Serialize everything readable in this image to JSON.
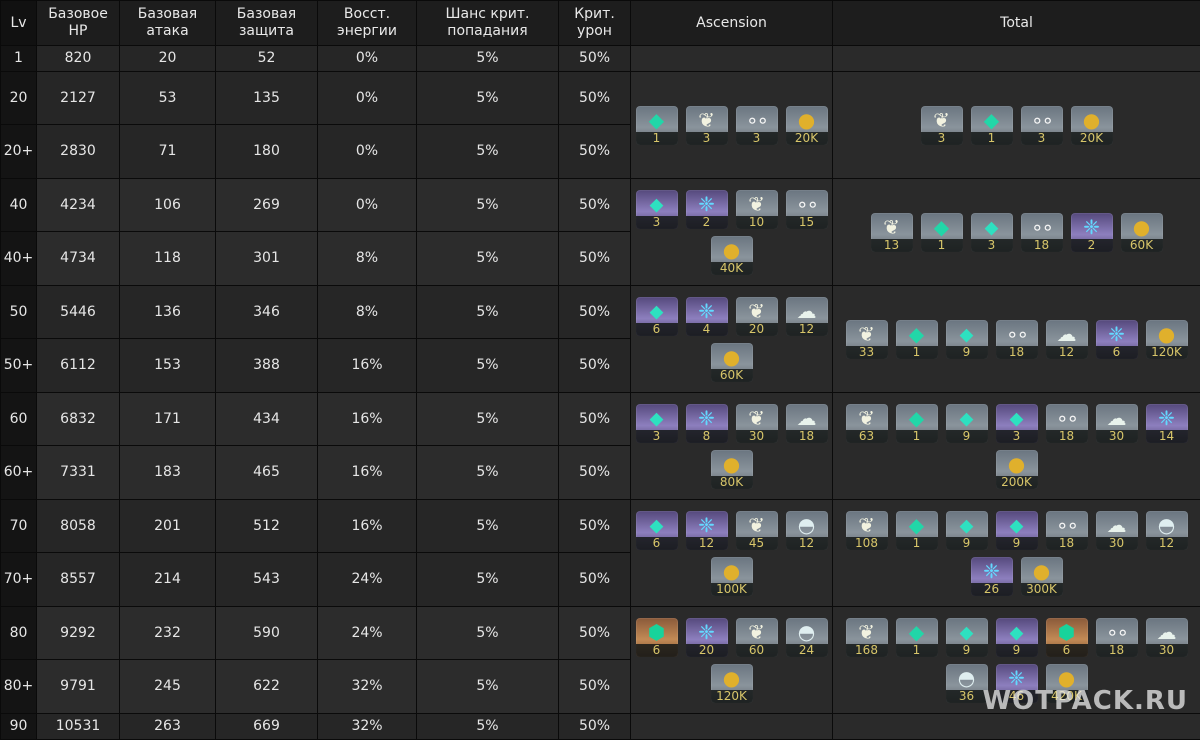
{
  "headers": {
    "lv": "Lv",
    "hp": "Базовое HP",
    "atk": "Базовая атака",
    "def": "Базовая защита",
    "er": "Восст. энергии",
    "crit_rate": "Шанс крит. попадания",
    "crit_dmg": "Крит. урон",
    "ascension": "Ascension",
    "total": "Total"
  },
  "rows": [
    {
      "lv": "1",
      "hp": "820",
      "atk": "20",
      "def": "52",
      "er": "0%",
      "cr": "5%",
      "cd": "50%"
    },
    {
      "lv": "20",
      "hp": "2127",
      "atk": "53",
      "def": "135",
      "er": "0%",
      "cr": "5%",
      "cd": "50%"
    },
    {
      "lv": "20+",
      "hp": "2830",
      "atk": "71",
      "def": "180",
      "er": "0%",
      "cr": "5%",
      "cd": "50%"
    },
    {
      "lv": "40",
      "hp": "4234",
      "atk": "106",
      "def": "269",
      "er": "0%",
      "cr": "5%",
      "cd": "50%"
    },
    {
      "lv": "40+",
      "hp": "4734",
      "atk": "118",
      "def": "301",
      "er": "8%",
      "cr": "5%",
      "cd": "50%"
    },
    {
      "lv": "50",
      "hp": "5446",
      "atk": "136",
      "def": "346",
      "er": "8%",
      "cr": "5%",
      "cd": "50%"
    },
    {
      "lv": "50+",
      "hp": "6112",
      "atk": "153",
      "def": "388",
      "er": "16%",
      "cr": "5%",
      "cd": "50%"
    },
    {
      "lv": "60",
      "hp": "6832",
      "atk": "171",
      "def": "434",
      "er": "16%",
      "cr": "5%",
      "cd": "50%"
    },
    {
      "lv": "60+",
      "hp": "7331",
      "atk": "183",
      "def": "465",
      "er": "16%",
      "cr": "5%",
      "cd": "50%"
    },
    {
      "lv": "70",
      "hp": "8058",
      "atk": "201",
      "def": "512",
      "er": "16%",
      "cr": "5%",
      "cd": "50%"
    },
    {
      "lv": "70+",
      "hp": "8557",
      "atk": "214",
      "def": "543",
      "er": "24%",
      "cr": "5%",
      "cd": "50%"
    },
    {
      "lv": "80",
      "hp": "9292",
      "atk": "232",
      "def": "590",
      "er": "24%",
      "cr": "5%",
      "cd": "50%"
    },
    {
      "lv": "80+",
      "hp": "9791",
      "atk": "245",
      "def": "622",
      "er": "32%",
      "cr": "5%",
      "cd": "50%"
    },
    {
      "lv": "90",
      "hp": "10531",
      "atk": "263",
      "def": "669",
      "er": "32%",
      "cr": "5%",
      "cd": "50%"
    }
  ],
  "ascension": [
    [
      {
        "icon": "crystal",
        "count": "1"
      },
      {
        "icon": "sprout",
        "count": "3"
      },
      {
        "icon": "pebbles",
        "count": "3"
      },
      {
        "icon": "coin",
        "count": "20K"
      }
    ],
    [
      {
        "icon": "shard",
        "count": "3",
        "tier": "rare"
      },
      {
        "icon": "wings",
        "count": "2",
        "tier": "rare"
      },
      {
        "icon": "sprout",
        "count": "10"
      },
      {
        "icon": "pebbles",
        "count": "15"
      },
      {
        "icon": "coin",
        "count": "40K"
      }
    ],
    [
      {
        "icon": "shard",
        "count": "6",
        "tier": "rare"
      },
      {
        "icon": "wings",
        "count": "4",
        "tier": "rare"
      },
      {
        "icon": "sprout",
        "count": "20"
      },
      {
        "icon": "cloud",
        "count": "12"
      },
      {
        "icon": "coin",
        "count": "60K"
      }
    ],
    [
      {
        "icon": "shard",
        "count": "3",
        "tier": "rare"
      },
      {
        "icon": "wings",
        "count": "8",
        "tier": "rare"
      },
      {
        "icon": "sprout",
        "count": "30"
      },
      {
        "icon": "cloud",
        "count": "18"
      },
      {
        "icon": "coin",
        "count": "80K"
      }
    ],
    [
      {
        "icon": "shard",
        "count": "6",
        "tier": "rare"
      },
      {
        "icon": "wings",
        "count": "12",
        "tier": "rare"
      },
      {
        "icon": "sprout",
        "count": "45"
      },
      {
        "icon": "dome",
        "count": "12"
      },
      {
        "icon": "coin",
        "count": "100K"
      }
    ],
    [
      {
        "icon": "gem",
        "count": "6",
        "tier": "epic"
      },
      {
        "icon": "wings",
        "count": "20",
        "tier": "rare"
      },
      {
        "icon": "sprout",
        "count": "60"
      },
      {
        "icon": "dome",
        "count": "24"
      },
      {
        "icon": "coin",
        "count": "120K"
      }
    ]
  ],
  "totals": [
    [
      {
        "icon": "sprout",
        "count": "3"
      },
      {
        "icon": "crystal",
        "count": "1"
      },
      {
        "icon": "pebbles",
        "count": "3"
      },
      {
        "icon": "coin",
        "count": "20K"
      }
    ],
    [
      {
        "icon": "sprout",
        "count": "13"
      },
      {
        "icon": "crystal",
        "count": "1"
      },
      {
        "icon": "shard",
        "count": "3"
      },
      {
        "icon": "pebbles",
        "count": "18"
      },
      {
        "icon": "wings",
        "count": "2",
        "tier": "rare"
      },
      {
        "icon": "coin",
        "count": "60K"
      }
    ],
    [
      {
        "icon": "sprout",
        "count": "33"
      },
      {
        "icon": "crystal",
        "count": "1"
      },
      {
        "icon": "shard",
        "count": "9"
      },
      {
        "icon": "pebbles",
        "count": "18"
      },
      {
        "icon": "cloud",
        "count": "12"
      },
      {
        "icon": "wings",
        "count": "6",
        "tier": "rare"
      },
      {
        "icon": "coin",
        "count": "120K"
      }
    ],
    [
      {
        "icon": "sprout",
        "count": "63"
      },
      {
        "icon": "crystal",
        "count": "1"
      },
      {
        "icon": "shard",
        "count": "9"
      },
      {
        "icon": "shard",
        "count": "3",
        "tier": "rare"
      },
      {
        "icon": "pebbles",
        "count": "18"
      },
      {
        "icon": "cloud",
        "count": "30"
      },
      {
        "icon": "wings",
        "count": "14",
        "tier": "rare"
      },
      {
        "icon": "coin",
        "count": "200K"
      }
    ],
    [
      {
        "icon": "sprout",
        "count": "108"
      },
      {
        "icon": "crystal",
        "count": "1"
      },
      {
        "icon": "shard",
        "count": "9"
      },
      {
        "icon": "shard",
        "count": "9",
        "tier": "rare"
      },
      {
        "icon": "pebbles",
        "count": "18"
      },
      {
        "icon": "cloud",
        "count": "30"
      },
      {
        "icon": "dome",
        "count": "12"
      },
      {
        "icon": "wings",
        "count": "26",
        "tier": "rare"
      },
      {
        "icon": "coin",
        "count": "300K"
      }
    ],
    [
      {
        "icon": "sprout",
        "count": "168"
      },
      {
        "icon": "crystal",
        "count": "1"
      },
      {
        "icon": "shard",
        "count": "9"
      },
      {
        "icon": "shard",
        "count": "9",
        "tier": "rare"
      },
      {
        "icon": "gem",
        "count": "6",
        "tier": "epic"
      },
      {
        "icon": "pebbles",
        "count": "18"
      },
      {
        "icon": "cloud",
        "count": "30"
      },
      {
        "icon": "dome",
        "count": "36"
      },
      {
        "icon": "wings",
        "count": "46",
        "tier": "rare"
      },
      {
        "icon": "coin",
        "count": "420K"
      }
    ]
  ],
  "watermark": "WOTPACK.RU"
}
